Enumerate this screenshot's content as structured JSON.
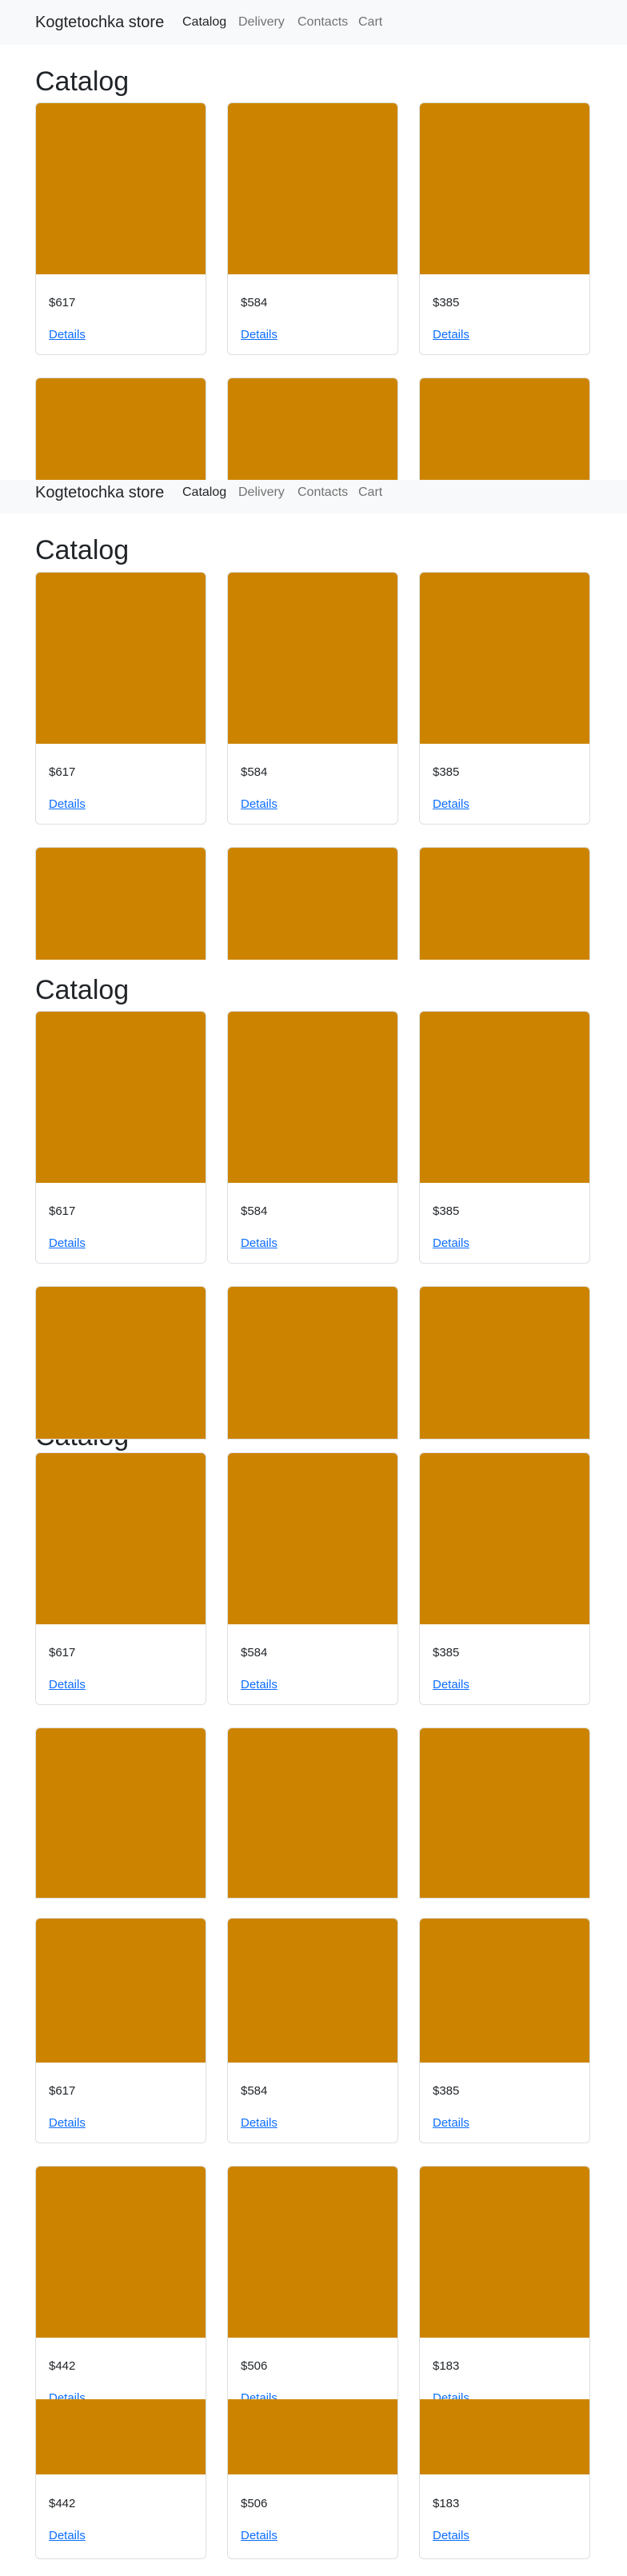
{
  "navbar": {
    "brand": "Kogtetochka store",
    "links": [
      "Catalog",
      "Delivery",
      "Contacts",
      "Cart"
    ]
  },
  "page": {
    "title": "Catalog"
  },
  "products": [
    {
      "price": "$617",
      "details_label": "Details"
    },
    {
      "price": "$584",
      "details_label": "Details"
    },
    {
      "price": "$385",
      "details_label": "Details"
    },
    {
      "price": "$442",
      "details_label": "Details"
    },
    {
      "price": "$506",
      "details_label": "Details"
    },
    {
      "price": "$183",
      "details_label": "Details"
    }
  ],
  "colors": {
    "product_image": "#cc8400",
    "link": "#0d6efd",
    "navbar_bg": "#f8f9fa"
  }
}
